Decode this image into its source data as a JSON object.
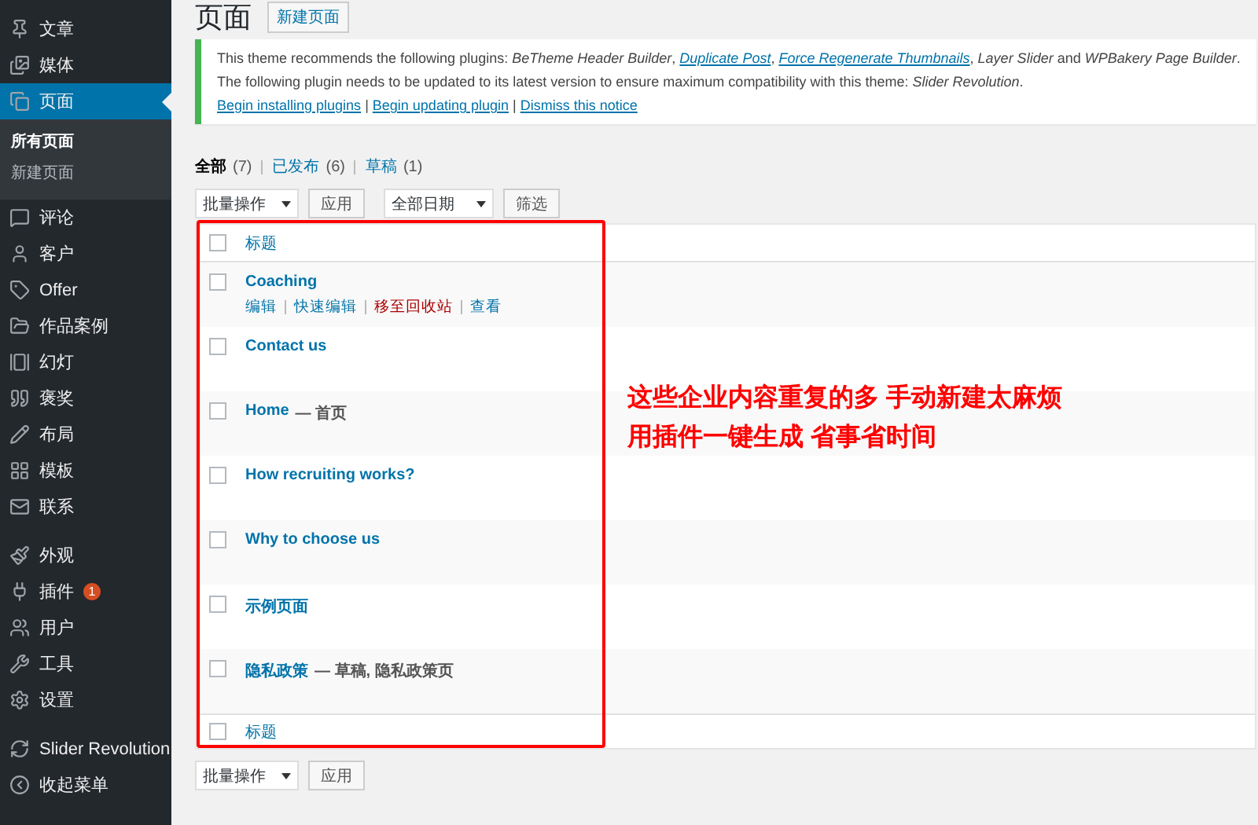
{
  "sidebar": {
    "groups": [
      [
        {
          "label": "文章",
          "selected": false
        },
        {
          "label": "媒体",
          "selected": false
        },
        {
          "label": "页面",
          "selected": true,
          "children": [
            {
              "label": "所有页面",
              "selected": true
            },
            {
              "label": "新建页面",
              "selected": false
            }
          ]
        },
        {
          "label": "评论",
          "selected": false
        },
        {
          "label": "客户",
          "selected": false
        },
        {
          "label": "Offer",
          "selected": false
        },
        {
          "label": "作品案例",
          "selected": false
        },
        {
          "label": "幻灯",
          "selected": false
        },
        {
          "label": "褒奖",
          "selected": false
        },
        {
          "label": "布局",
          "selected": false
        },
        {
          "label": "模板",
          "selected": false
        },
        {
          "label": "联系",
          "selected": false
        }
      ],
      [
        {
          "label": "外观",
          "selected": false
        },
        {
          "label": "插件",
          "selected": false,
          "badge": "1"
        },
        {
          "label": "用户",
          "selected": false
        },
        {
          "label": "工具",
          "selected": false
        },
        {
          "label": "设置",
          "selected": false
        }
      ],
      [
        {
          "label": "Slider Revolution",
          "selected": false
        },
        {
          "label": "收起菜单",
          "selected": false
        }
      ]
    ]
  },
  "header": {
    "title": "页面",
    "add_button": "新建页面"
  },
  "notice": {
    "lines": [
      [
        {
          "kind": "text",
          "text": "This theme recommends the following plugins: *BeTheme Header Builder*, "
        },
        {
          "kind": "link",
          "text": "Duplicate Post"
        },
        {
          "kind": "link",
          "lead": ", ",
          "text": "Force Regenerate Thumbnails"
        },
        {
          "kind": "text",
          "text": ", *Layer Slider* and *WPBakery Page Builder*."
        }
      ],
      [
        {
          "kind": "text",
          "text": "The following plugin needs to be updated to its latest version to ensure maximum compatibility with this theme: *Slider Revolution*."
        }
      ],
      [
        {
          "kind": "action",
          "text": "Begin installing plugins"
        },
        {
          "kind": "sep",
          "text": " | "
        },
        {
          "kind": "action",
          "text": "Begin updating plugin"
        },
        {
          "kind": "sep",
          "text": " | "
        },
        {
          "kind": "action",
          "text": "Dismiss this notice"
        }
      ]
    ]
  },
  "views": [
    {
      "label": "全部",
      "count": "(7)",
      "selected": true
    },
    {
      "label": "已发布",
      "count": "(6)",
      "selected": false
    },
    {
      "label": "草稿",
      "count": "(1)",
      "selected": false
    }
  ],
  "top_actions": {
    "bulk_select": "批量操作",
    "apply": "应用",
    "date_select": "全部日期",
    "filter": "筛选"
  },
  "table": {
    "header": "标题",
    "header_checked": false,
    "footer": "标题",
    "footer_checked": false,
    "rows": [
      {
        "title": "Coaching",
        "checked": false,
        "actions": [
          {
            "label": "编辑",
            "kind": "link"
          },
          {
            "label": "快速编辑",
            "kind": "link"
          },
          {
            "label": "移至回收站",
            "kind": "trash"
          },
          {
            "label": "查看",
            "kind": "link"
          }
        ]
      },
      {
        "title": "Contact us",
        "checked": false
      },
      {
        "title": "Home",
        "state": "— 首页",
        "checked": false
      },
      {
        "title": "How recruiting works?",
        "checked": false
      },
      {
        "title": "Why to choose us",
        "checked": false
      },
      {
        "title": "示例页面",
        "checked": false
      },
      {
        "title": "隐私政策",
        "state": "— 草稿, 隐私政策页",
        "checked": false
      }
    ]
  },
  "annotation": {
    "lines": [
      "这些企业内容重复的多 手动新建太麻烦",
      "用插件一键生成 省事省时间"
    ]
  },
  "bottom_actions": {
    "bulk_select": "批量操作",
    "apply": "应用"
  }
}
